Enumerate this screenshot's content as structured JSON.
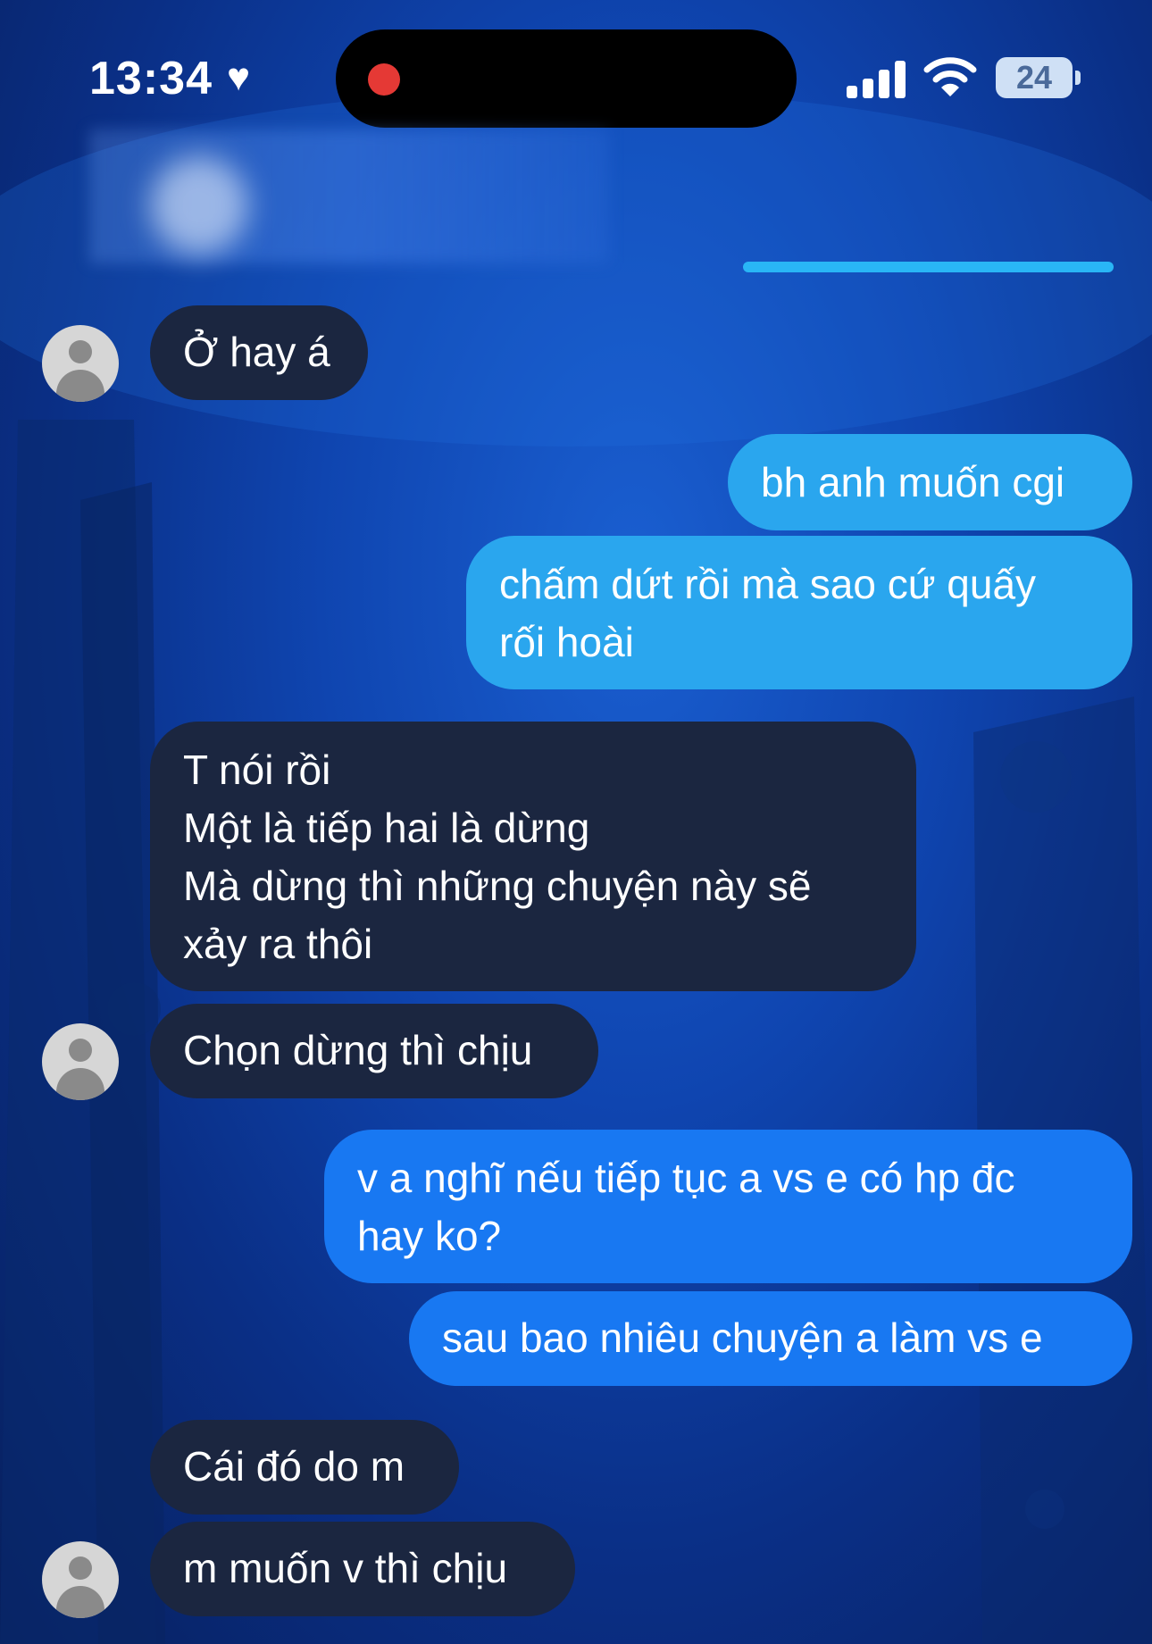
{
  "status": {
    "time": "13:34",
    "battery": "24"
  },
  "icons": {
    "heart": "heart-icon",
    "recording": "recording-dot-icon",
    "signal": "cellular-signal-icon",
    "wifi": "wifi-icon",
    "battery": "battery-icon",
    "avatar": "avatar-icon"
  },
  "colors": {
    "incoming": "#1b2640",
    "outgoing_cyan": "#2aa6ee",
    "outgoing_blue": "#1878f2",
    "accent": "#29b6f6"
  },
  "messages": [
    {
      "text": "Ở hay á"
    },
    {
      "text": "bh anh muốn cgi"
    },
    {
      "text": "chấm dứt rồi mà sao cứ quấy\nrối hoài"
    },
    {
      "text": "T nói rồi\nMột là tiếp hai là dừng\nMà dừng thì những chuyện này sẽ\nxảy ra thôi"
    },
    {
      "text": "Chọn dừng thì chịu"
    },
    {
      "text": "v a nghĩ nếu tiếp tục a vs e có hp đc\nhay ko?"
    },
    {
      "text": "sau bao nhiêu chuyện a làm vs e"
    },
    {
      "text": "Cái đó do m"
    },
    {
      "text": "m muốn v thì chịu"
    }
  ]
}
